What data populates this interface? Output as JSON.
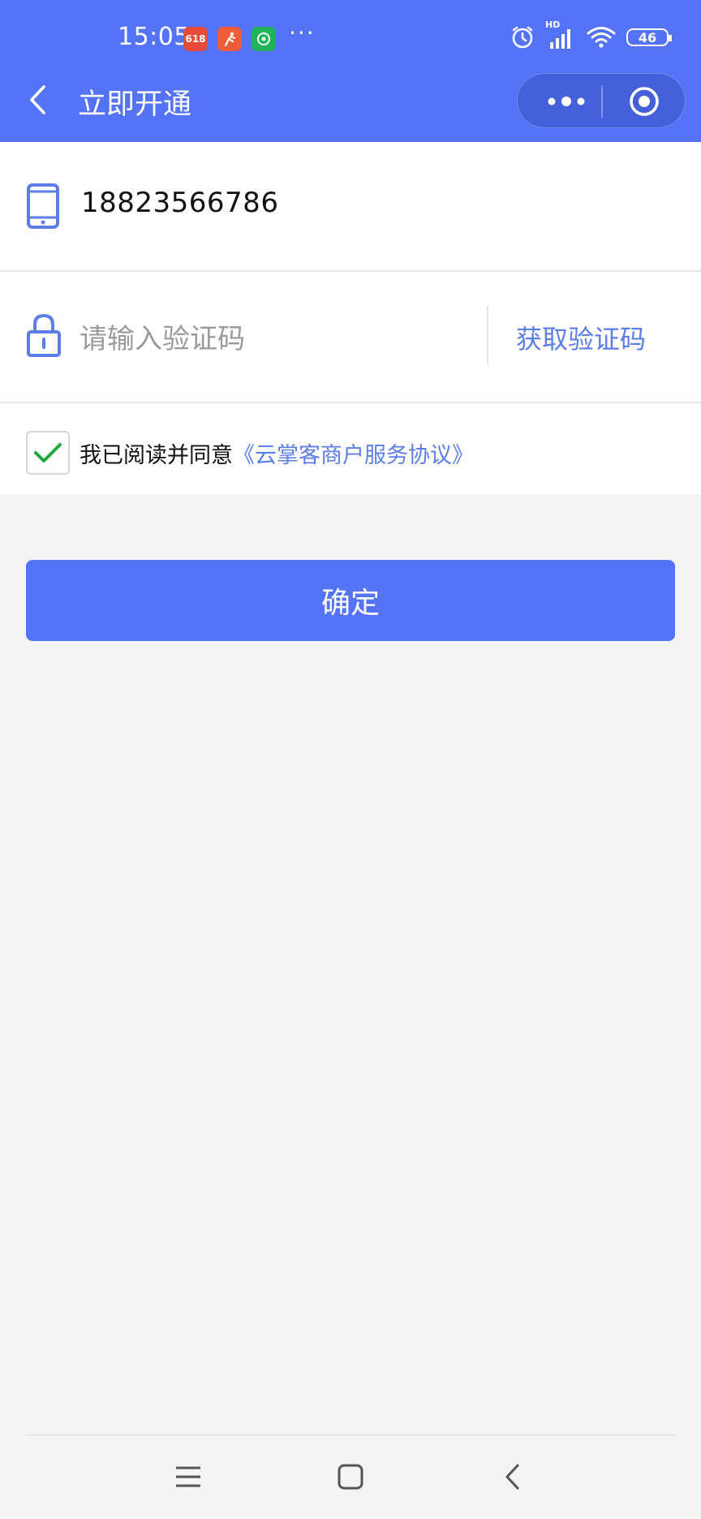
{
  "status_bar": {
    "time": "15:05",
    "app_icons": [
      {
        "name": "shopping-618-icon",
        "label": "618",
        "color": "#e64a3a"
      },
      {
        "name": "runner-app-icon",
        "label": "",
        "color": "#f05b3a"
      },
      {
        "name": "message-app-icon",
        "label": "",
        "color": "#21b35a"
      }
    ],
    "dots": "···",
    "network": "HD",
    "battery": "46"
  },
  "header": {
    "title": "立即开通",
    "background_color": "#5473f6"
  },
  "form": {
    "phone_value": "18823566786",
    "code_placeholder": "请输入验证码",
    "get_code_label": "获取验证码",
    "agree_prefix": "我已阅读并同意",
    "agree_link": "《云掌客商户服务协议》",
    "agree_checked": true,
    "accent_color": "#5c7ee8"
  },
  "confirm_label": "确定"
}
